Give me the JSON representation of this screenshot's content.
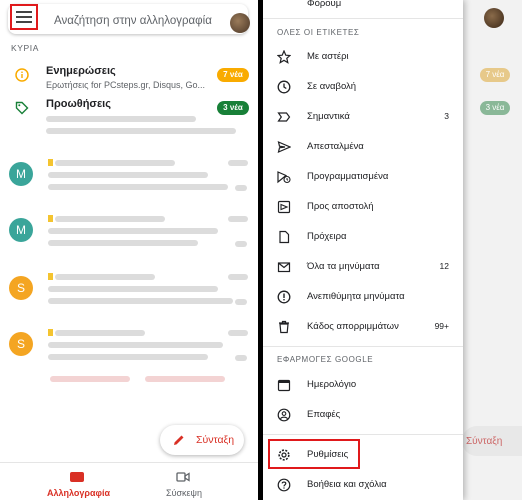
{
  "left": {
    "search_placeholder": "Αναζήτηση στην αλληλογραφία",
    "section_label": "ΚΥΡΙΑ",
    "categories": [
      {
        "title": "Ενημερώσεις",
        "subtitle": "Ερωτήσεις for PCsteps.gr, Disqus, Go...",
        "badge": "7 νέα",
        "badge_color": "#f9ab00"
      },
      {
        "title": "Προωθήσεις",
        "subtitle": "",
        "badge": "3 νέα",
        "badge_color": "#188038"
      }
    ],
    "mails": [
      {
        "initial": "M",
        "color": "#3aa59a"
      },
      {
        "initial": "M",
        "color": "#3aa59a"
      },
      {
        "initial": "S",
        "color": "#f4a522"
      },
      {
        "initial": "S",
        "color": "#f4a522"
      }
    ],
    "compose_label": "Σύνταξη",
    "nav": {
      "mail_label": "Αλληλογραφία",
      "meet_label": "Σύσκεψη"
    }
  },
  "right_bg": {
    "badge1": "7 νέα",
    "badge2": "3 νέα",
    "compose_label": "Σύνταξη"
  },
  "drawer": {
    "top_item": "Φόρουμ",
    "all_labels_header": "ΟΛΕΣ ΟΙ ΕΤΙΚΕΤΕΣ",
    "items": [
      {
        "label": "Με αστέρι",
        "count": "",
        "icon": "star-icon"
      },
      {
        "label": "Σε αναβολή",
        "count": "",
        "icon": "clock-icon"
      },
      {
        "label": "Σημαντικά",
        "count": "3",
        "icon": "important-icon"
      },
      {
        "label": "Απεσταλμένα",
        "count": "",
        "icon": "send-icon"
      },
      {
        "label": "Προγραμματισμένα",
        "count": "",
        "icon": "scheduled-send-icon"
      },
      {
        "label": "Προς αποστολή",
        "count": "",
        "icon": "outbox-icon"
      },
      {
        "label": "Πρόχειρα",
        "count": "",
        "icon": "draft-icon"
      },
      {
        "label": "Όλα τα μηνύματα",
        "count": "12",
        "icon": "all-mail-icon"
      },
      {
        "label": "Ανεπιθύμητα μηνύματα",
        "count": "",
        "icon": "spam-icon"
      },
      {
        "label": "Κάδος απορριμμάτων",
        "count": "99+",
        "icon": "trash-icon"
      }
    ],
    "apps_header": "ΕΦΑΡΜΟΓΕΣ GOOGLE",
    "apps": [
      {
        "label": "Ημερολόγιο",
        "icon": "calendar-icon"
      },
      {
        "label": "Επαφές",
        "icon": "contacts-icon"
      }
    ],
    "settings_label": "Ρυθμίσεις",
    "help_label": "Βοήθεια και σχόλια"
  }
}
